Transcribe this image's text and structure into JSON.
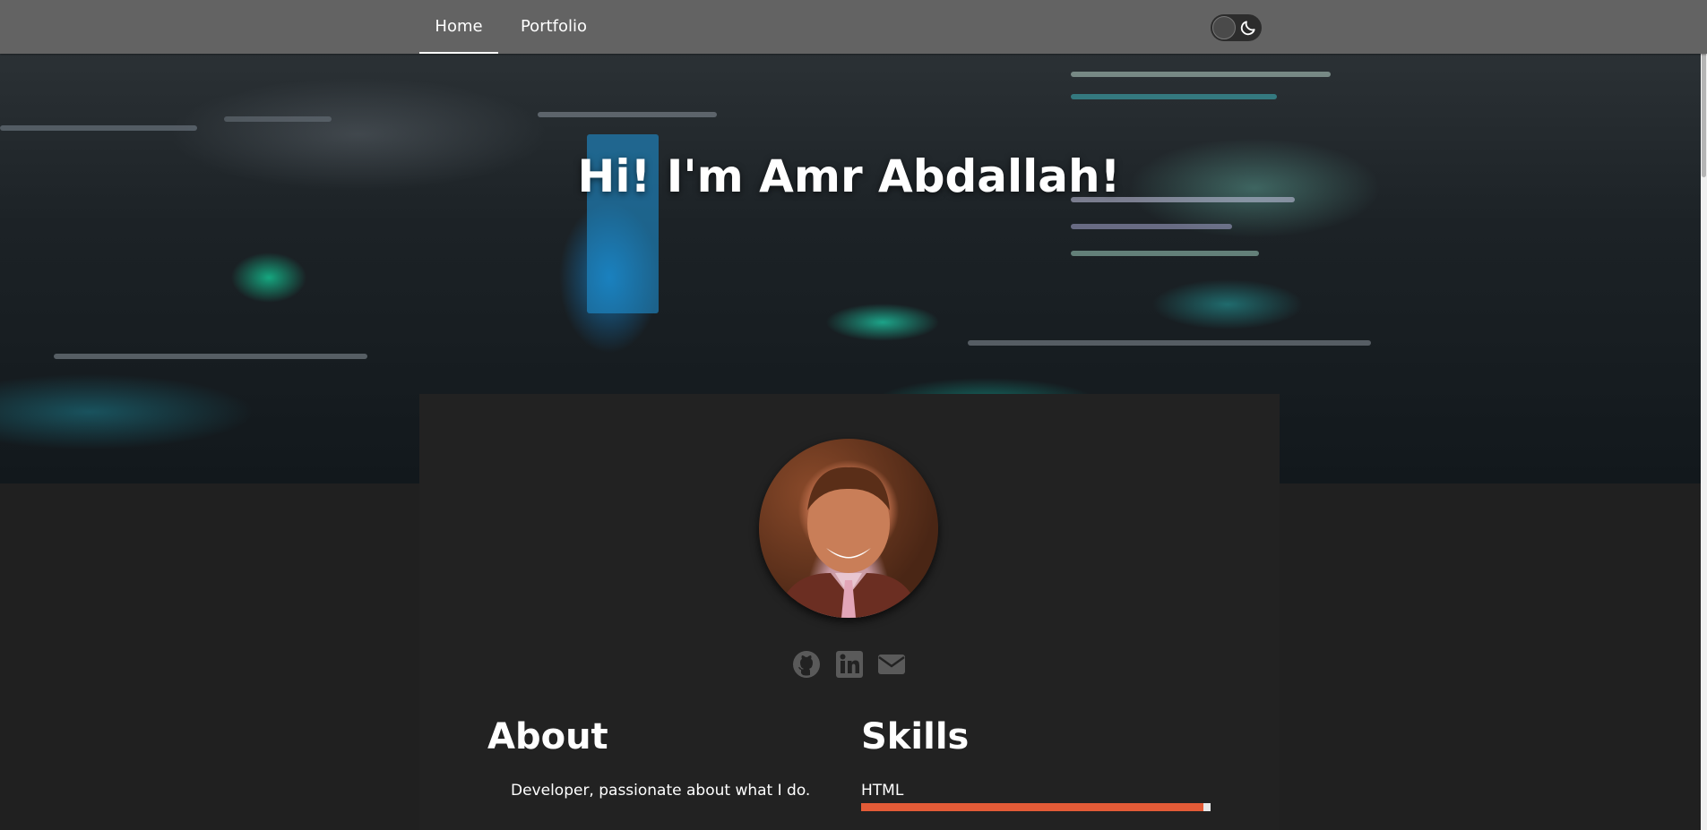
{
  "nav": {
    "items": [
      {
        "label": "Home",
        "active": true
      },
      {
        "label": "Portfolio",
        "active": false
      }
    ]
  },
  "theme_toggle": {
    "icon": "moon-icon",
    "state": "dark"
  },
  "hero": {
    "title": "Hi! I'm Amr Abdallah!"
  },
  "social": [
    {
      "icon": "github-icon"
    },
    {
      "icon": "linkedin-icon"
    },
    {
      "icon": "envelope-icon"
    }
  ],
  "about": {
    "title": "About",
    "text": "Developer, passionate about what I do."
  },
  "skills": {
    "title": "Skills",
    "items": [
      {
        "label": "HTML",
        "level": 0.98
      }
    ]
  },
  "colors": {
    "navbar": "#636363",
    "background": "#202020",
    "card": "#222222",
    "skill_bar": "#e35b37",
    "icons": "#5a5a5a"
  }
}
